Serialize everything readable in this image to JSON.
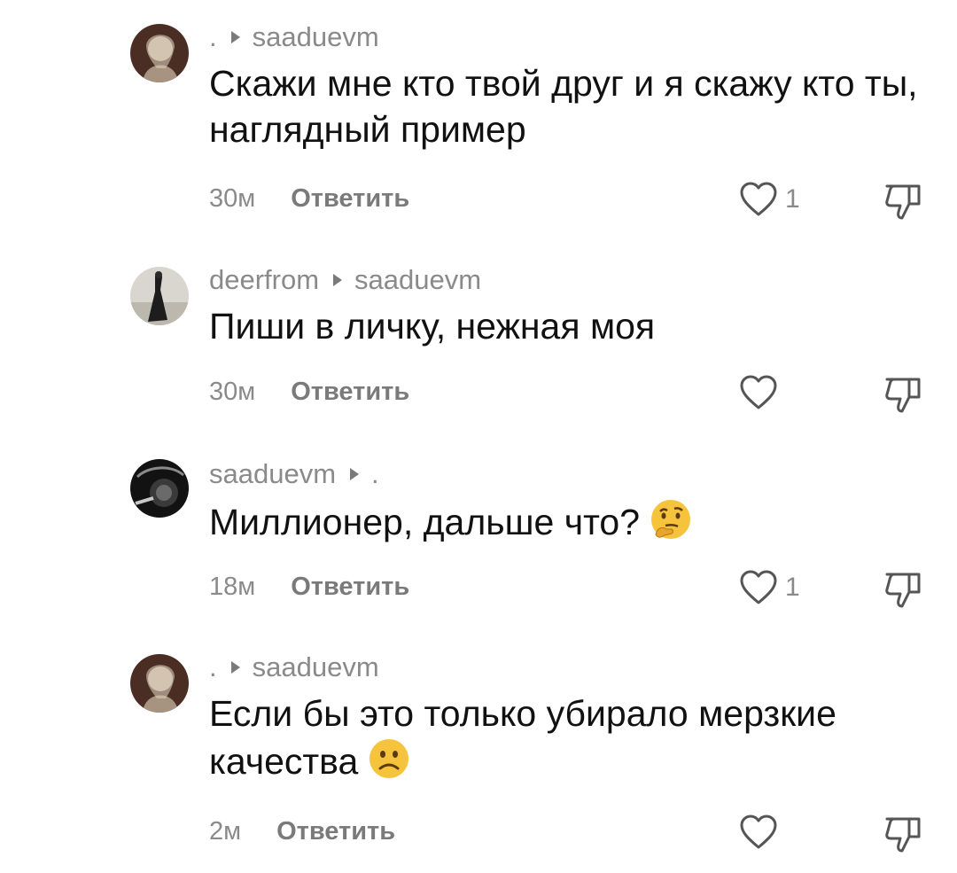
{
  "comments": [
    {
      "author": ".",
      "reply_to": "saaduevm",
      "text": "Скажи мне кто твой друг и я скажу кто ты, наглядный пример",
      "emoji": "",
      "time": "30м",
      "reply_label": "Ответить",
      "likes": "1"
    },
    {
      "author": "deerfrom",
      "reply_to": "saaduevm",
      "text": "Пиши в личку, нежная моя",
      "emoji": "",
      "time": "30м",
      "reply_label": "Ответить",
      "likes": ""
    },
    {
      "author": "saaduevm",
      "reply_to": ".",
      "text": "Миллионер, дальше что?",
      "emoji": "thinking-face",
      "time": "18м",
      "reply_label": "Ответить",
      "likes": "1"
    },
    {
      "author": ".",
      "reply_to": "saaduevm",
      "text": "Если бы это только убирало мерзкие качества",
      "emoji": "frowning-face",
      "time": "2м",
      "reply_label": "Ответить",
      "likes": ""
    }
  ],
  "colors": {
    "text": "#111111",
    "secondary": "#8a8a8a",
    "icon": "#555555"
  }
}
